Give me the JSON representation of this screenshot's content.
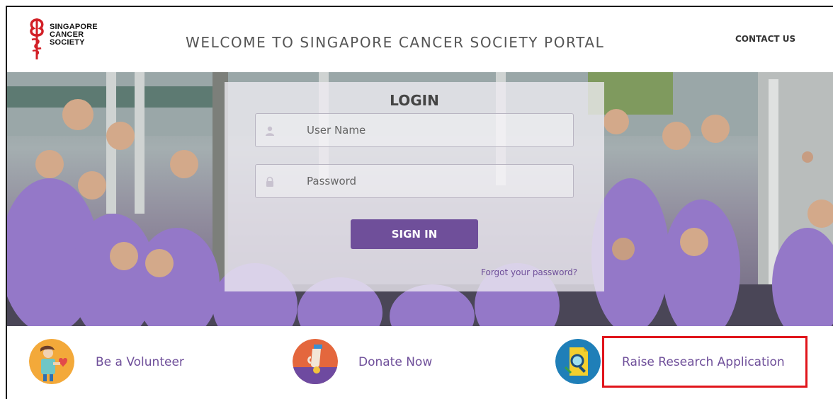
{
  "header": {
    "logo_lines": [
      "SINGAPORE",
      "CANCER",
      "SOCIETY"
    ],
    "title": "WELCOME TO SINGAPORE CANCER SOCIETY PORTAL",
    "contact_label": "CONTACT US"
  },
  "login": {
    "title": "LOGIN",
    "username_placeholder": "User Name",
    "password_placeholder": "Password",
    "signin_label": "SIGN IN",
    "forgot_label": "Forgot your password?"
  },
  "actions": [
    {
      "label": "Be a Volunteer",
      "icon": "volunteer-icon"
    },
    {
      "label": "Donate Now",
      "icon": "donate-icon"
    },
    {
      "label": "Raise Research Application",
      "icon": "research-icon"
    }
  ],
  "colors": {
    "brand_purple": "#6f4f9a",
    "highlight_red": "#e0141b",
    "logo_red": "#d21f26"
  }
}
